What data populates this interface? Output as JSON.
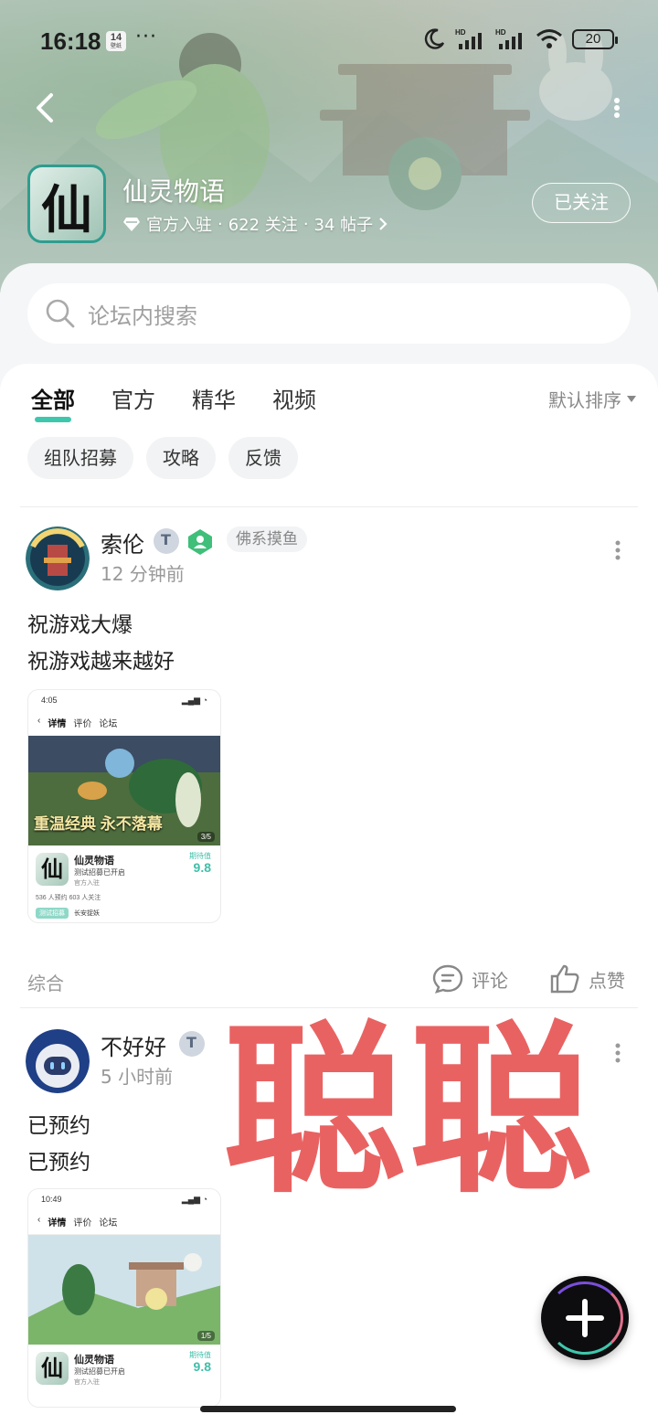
{
  "status_bar": {
    "time": "16:18",
    "badge_num": "14",
    "badge_sub": "壁纸",
    "dots": "···",
    "battery": "20"
  },
  "header": {
    "game_icon_char": "仙",
    "game_title": "仙灵物语",
    "meta_official": "官方入驻",
    "meta_follow": "622 关注",
    "meta_posts": "34 帖子",
    "meta_sep": "·",
    "follow_button": "已关注"
  },
  "search": {
    "placeholder": "论坛内搜索"
  },
  "tabs": [
    {
      "label": "全部",
      "active": true
    },
    {
      "label": "官方",
      "active": false
    },
    {
      "label": "精华",
      "active": false
    },
    {
      "label": "视频",
      "active": false
    }
  ],
  "sort_label": "默认排序",
  "chips": [
    "组队招募",
    "攻略",
    "反馈"
  ],
  "posts": [
    {
      "author": "索伦",
      "time": "12 分钟前",
      "tag": "佛系摸鱼",
      "lines": [
        "祝游戏大爆",
        "祝游戏越来越好"
      ],
      "category": "综合",
      "comment_label": "评论",
      "like_label": "点赞",
      "thumb": {
        "status_time": "4:05",
        "status_dots": "·",
        "nav": [
          "详情",
          "评价",
          "论坛"
        ],
        "page": "3/5",
        "banner_text": "重温经典 永不落幕",
        "app_icon": "仙",
        "app_name": "仙灵物语",
        "app_sub": "测试招募已开启",
        "app_official": "官方入驻",
        "score_label": "期待值",
        "score": "9.8",
        "stats": "536 人预约   603 人关注",
        "foot_tag": "测试招募",
        "foot_text": "长安捉妖"
      }
    },
    {
      "author": "不好好",
      "time": "5 小时前",
      "lines": [
        "已预约",
        "已预约"
      ],
      "thumb": {
        "status_time": "10:49",
        "status_dots": "·",
        "nav": [
          "详情",
          "评价",
          "论坛"
        ],
        "page": "1/5",
        "app_icon": "仙",
        "app_name": "仙灵物语",
        "app_sub": "测试招募已开启",
        "app_official": "官方入驻",
        "score_label": "期待值",
        "score": "9.8"
      }
    }
  ],
  "watermark": "聪聪",
  "colors": {
    "accent": "#3fc7ad",
    "watermark": "#e85a5a"
  },
  "icons": [
    "back-arrow-icon",
    "more-vertical-icon",
    "diamond-icon",
    "chevron-right-icon",
    "search-icon",
    "comment-icon",
    "like-icon",
    "plus-icon",
    "moon-icon",
    "signal-icon",
    "wifi-icon"
  ]
}
